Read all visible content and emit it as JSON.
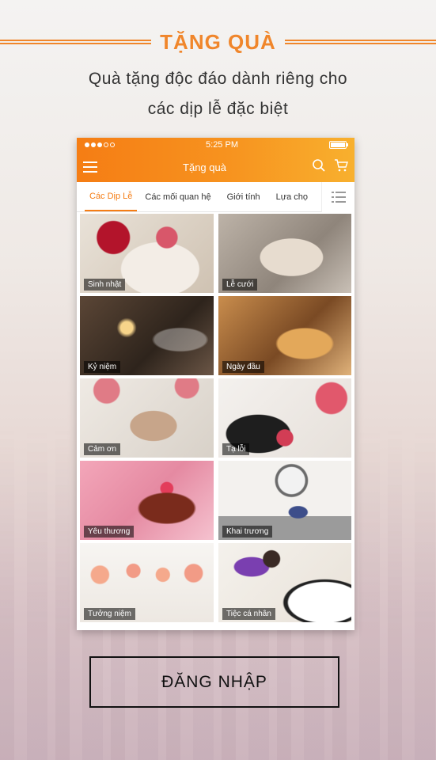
{
  "header": {
    "title": "TẶNG QUÀ",
    "subtitle_line1": "Quà tặng độc đáo dành riêng cho",
    "subtitle_line2": "các dịp lễ đặc biệt"
  },
  "phone": {
    "status_time": "5:25 PM",
    "screen_title": "Tặng quà",
    "tabs": [
      {
        "label": "Các Dịp Lễ",
        "active": true
      },
      {
        "label": "Các mối quan hệ",
        "active": false
      },
      {
        "label": "Giới tính",
        "active": false
      },
      {
        "label": "Lựa chọ",
        "active": false
      }
    ],
    "categories": [
      {
        "label": "Sinh nhật"
      },
      {
        "label": "Lễ cưới"
      },
      {
        "label": "Kỷ niệm"
      },
      {
        "label": "Ngày đầu"
      },
      {
        "label": "Cảm ơn"
      },
      {
        "label": "Tạ lỗi"
      },
      {
        "label": "Yêu thương"
      },
      {
        "label": "Khai trương"
      },
      {
        "label": "Tưởng niệm"
      },
      {
        "label": "Tiệc cá nhân"
      }
    ]
  },
  "login": {
    "label": "ĐĂNG NHẬP"
  },
  "colors": {
    "accent": "#f0862b",
    "appbar_start": "#f57d14",
    "appbar_end": "#f8b02e"
  },
  "icons": [
    "menu-icon",
    "search-icon",
    "cart-icon",
    "list-view-icon",
    "battery-icon",
    "signal-icon"
  ]
}
